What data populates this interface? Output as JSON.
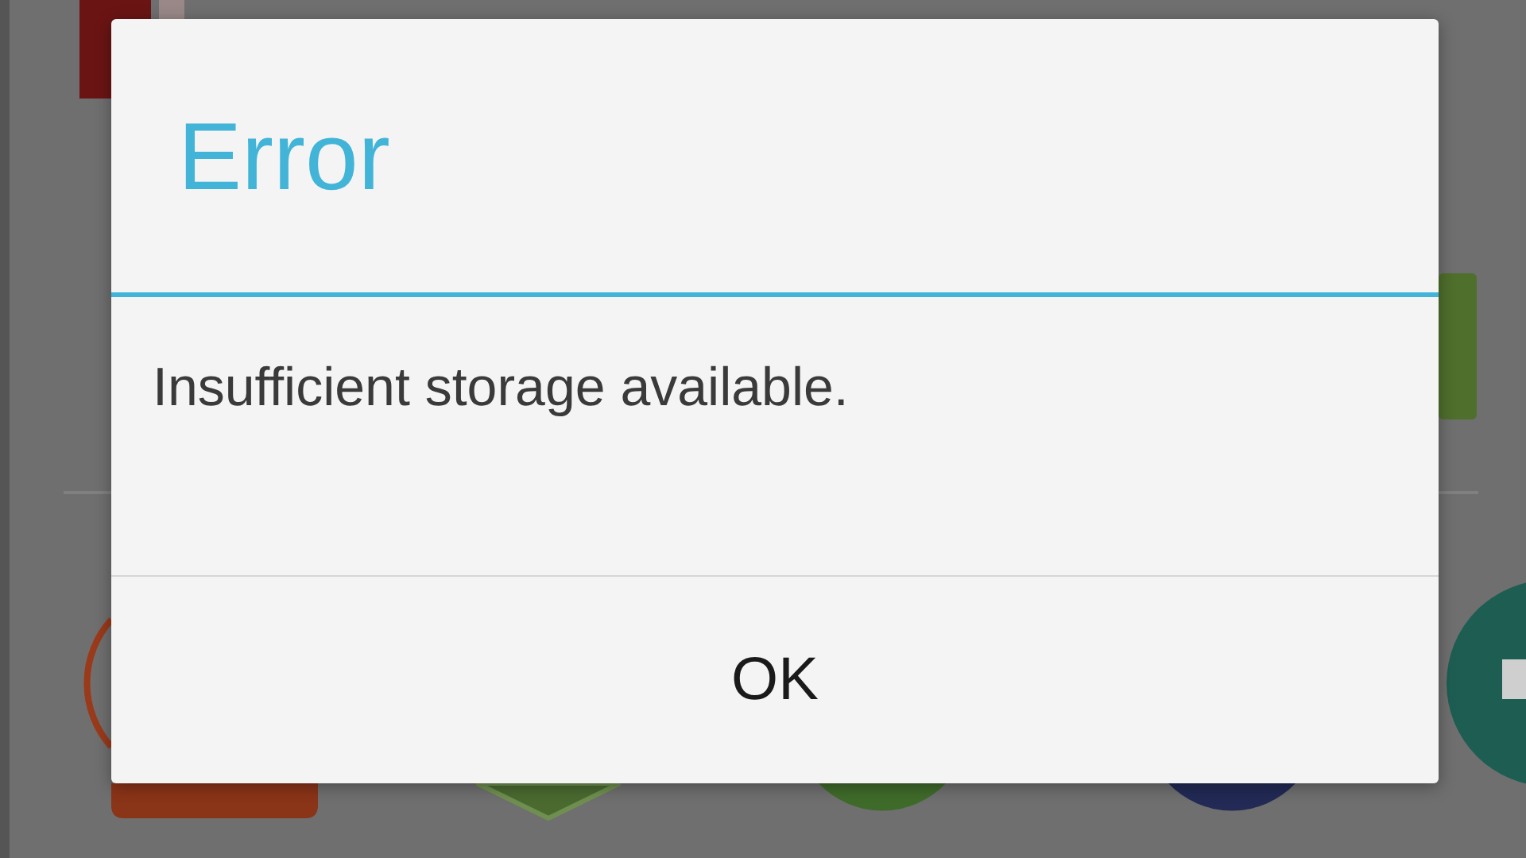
{
  "dialog": {
    "title": "Error",
    "message": "Insufficient storage available.",
    "buttons": [
      "OK"
    ]
  }
}
